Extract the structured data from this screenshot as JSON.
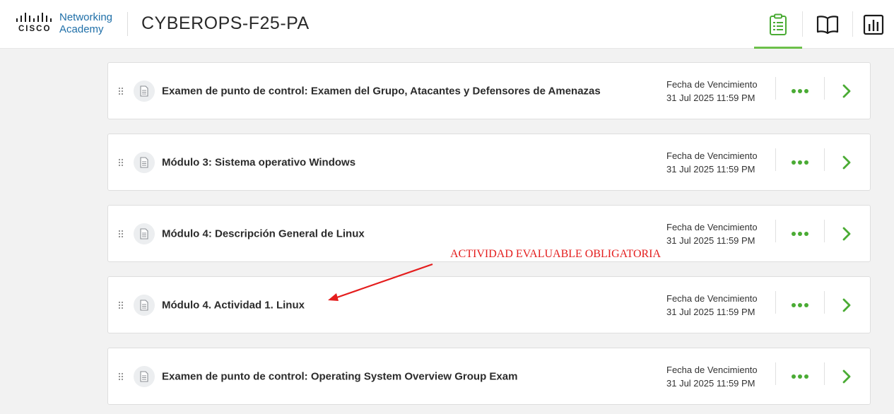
{
  "header": {
    "logo": {
      "wordmark": "CISCO",
      "brand_line1": "Networking",
      "brand_line2": "Academy"
    },
    "course_title": "CYBEROPS-F25-PA",
    "nav": [
      {
        "icon": "clipboard-list-icon",
        "active": true
      },
      {
        "icon": "open-book-icon",
        "active": false
      },
      {
        "icon": "bar-chart-icon",
        "active": false
      }
    ]
  },
  "colors": {
    "accent_green": "#6cc04a",
    "action_green": "#4aab34",
    "annotation_red": "#e41d1d",
    "brand_blue": "#1f6fa8"
  },
  "assignments": [
    {
      "title": "Examen de punto de control: Examen del Grupo, Atacantes y Defensores de Amenazas",
      "due_label": "Fecha de Vencimiento",
      "due_date": "31 Jul 2025 11:59 PM"
    },
    {
      "title": "Módulo 3: Sistema operativo Windows",
      "due_label": "Fecha de Vencimiento",
      "due_date": "31 Jul 2025 11:59 PM"
    },
    {
      "title": "Módulo 4: Descripción General de Linux",
      "due_label": "Fecha de Vencimiento",
      "due_date": "31 Jul 2025 11:59 PM"
    },
    {
      "title": "Módulo 4. Actividad 1. Linux",
      "due_label": "Fecha de Vencimiento",
      "due_date": "31 Jul 2025 11:59 PM"
    },
    {
      "title": "Examen de punto de control: Operating System Overview Group Exam",
      "due_label": "Fecha de Vencimiento",
      "due_date": "31 Jul 2025 11:59 PM"
    }
  ],
  "annotation": {
    "text": "ACTIVIDAD EVALUABLE OBLIGATORIA"
  }
}
